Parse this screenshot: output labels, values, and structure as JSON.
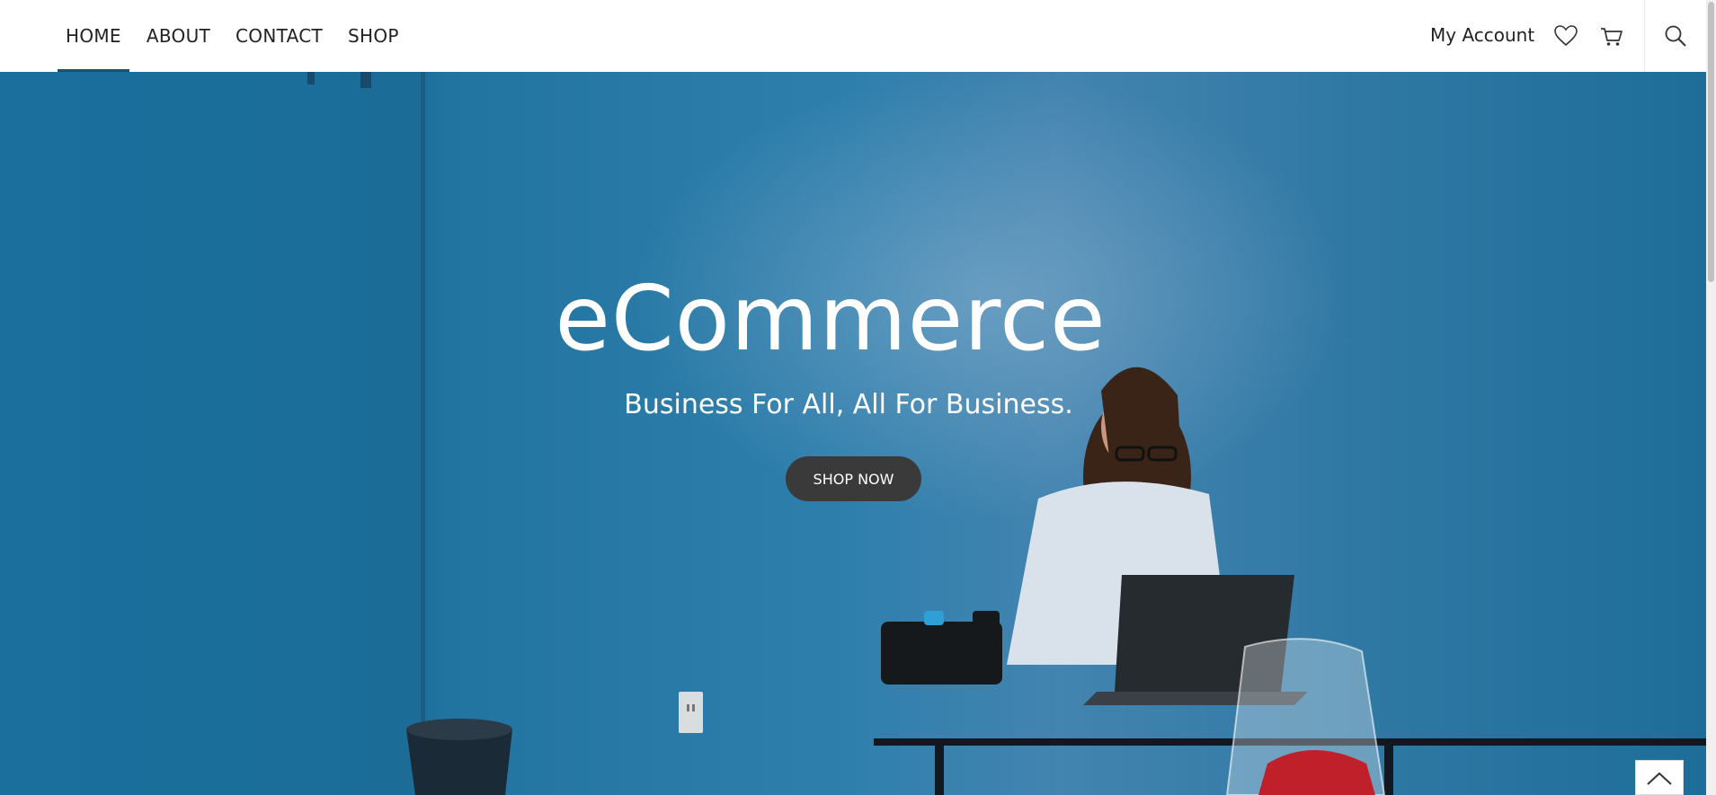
{
  "nav": {
    "items": [
      {
        "label": "HOME",
        "active": true
      },
      {
        "label": "ABOUT",
        "active": false
      },
      {
        "label": "CONTACT",
        "active": false
      },
      {
        "label": "SHOP",
        "active": false
      }
    ],
    "account_label": "My Account",
    "icons": [
      "heart-icon",
      "cart-icon",
      "search-icon"
    ]
  },
  "hero": {
    "title": "eCommerce",
    "subtitle": "Business For All, All For Business.",
    "cta_label": "SHOP NOW"
  },
  "colors": {
    "hero_blue": "#1b6d98",
    "button_bg": "#3a3a3a",
    "active_underline": "#1f4e6e"
  },
  "back_to_top_icon": "chevron-up-icon"
}
